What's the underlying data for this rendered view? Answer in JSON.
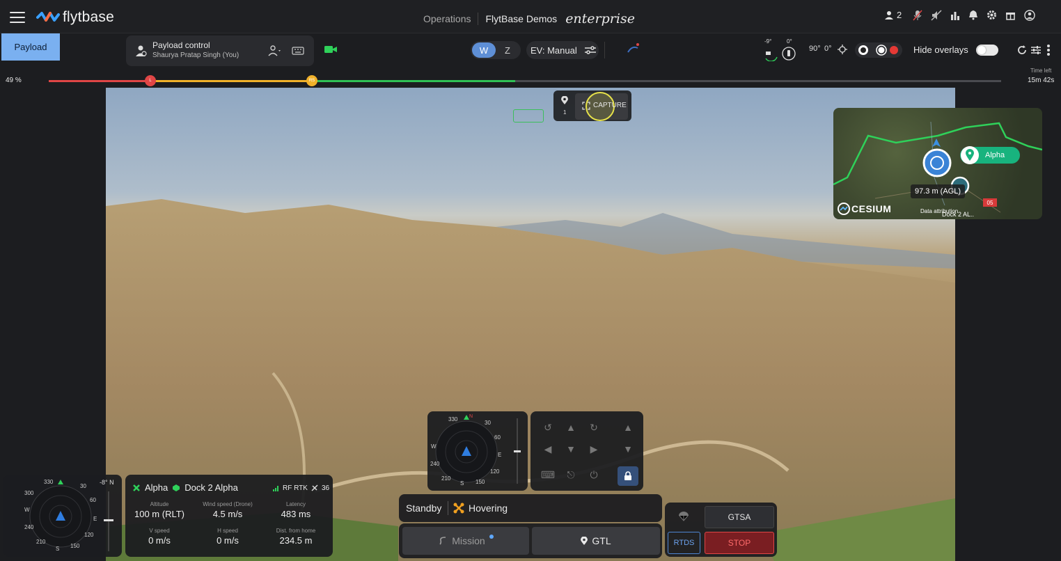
{
  "header": {
    "logo_text": "flytbase",
    "breadcrumb_ops": "Operations",
    "breadcrumb_org": "FlytBase Demos",
    "edition": "enterprise",
    "user_count": "2"
  },
  "toolbar": {
    "payload_tab": "Payload",
    "payload_control_title": "Payload control",
    "payload_control_user": "Shaurya Pratap Singh (You)",
    "mode_w": "W",
    "mode_z": "Z",
    "ev_label": "EV: Manual",
    "gimbal_pitch_left": "-9°",
    "gimbal_pitch_right": "0°",
    "gimbal_90": "90°",
    "gimbal_0": "0°",
    "hide_overlays": "Hide overlays",
    "hide_overlays_on": false
  },
  "battery": {
    "percent_text": "49 %",
    "percent_value": 49,
    "mark_l": "L",
    "mark_rth": "RS",
    "time_left_label": "Time left",
    "time_left_value": "15m 42s"
  },
  "capture": {
    "pin_count": "1",
    "label": "CAPTURE"
  },
  "minimap": {
    "drone_label": "Alpha",
    "altitude": "97.3 m (AGL)",
    "provider": "CESIUM",
    "attribution": "Data attribution",
    "dock_label": "Dock 2 AL..",
    "marker": "05"
  },
  "compass_left": {
    "heading_offset": "-8° N",
    "ticks": [
      "330",
      "30",
      "300",
      "60",
      "W",
      "E",
      "240",
      "120",
      "210",
      "150",
      "S",
      "N"
    ]
  },
  "telemetry": {
    "drone": "Alpha",
    "dock": "Dock 2 Alpha",
    "signal": "RF RTK",
    "satellites": "36",
    "cells": [
      {
        "label": "Altitude",
        "value": "100 m (RLT)"
      },
      {
        "label": "Wind speed (Drone)",
        "value": "4.5 m/s"
      },
      {
        "label": "Latency",
        "value": "483 ms"
      },
      {
        "label": "V speed",
        "value": "0 m/s"
      },
      {
        "label": "H speed",
        "value": "0 m/s"
      },
      {
        "label": "Dist. from home",
        "value": "234.5 m"
      }
    ]
  },
  "compass_center": {
    "ticks": [
      "330",
      "N",
      "30",
      "W",
      "60",
      "E",
      "240",
      "120",
      "210",
      "S",
      "150"
    ]
  },
  "status": {
    "state": "Standby",
    "flight": "Hovering"
  },
  "actions": {
    "mission": "Mission",
    "gtl": "GTL",
    "gtsa": "GTSA",
    "rtds": "RTDS",
    "stop": "STOP"
  },
  "colors": {
    "accent_blue": "#7ab0f0",
    "battery_red": "#e04646",
    "battery_yellow": "#f0b12a",
    "battery_green": "#2fbf55",
    "stop_red": "#e04646"
  }
}
